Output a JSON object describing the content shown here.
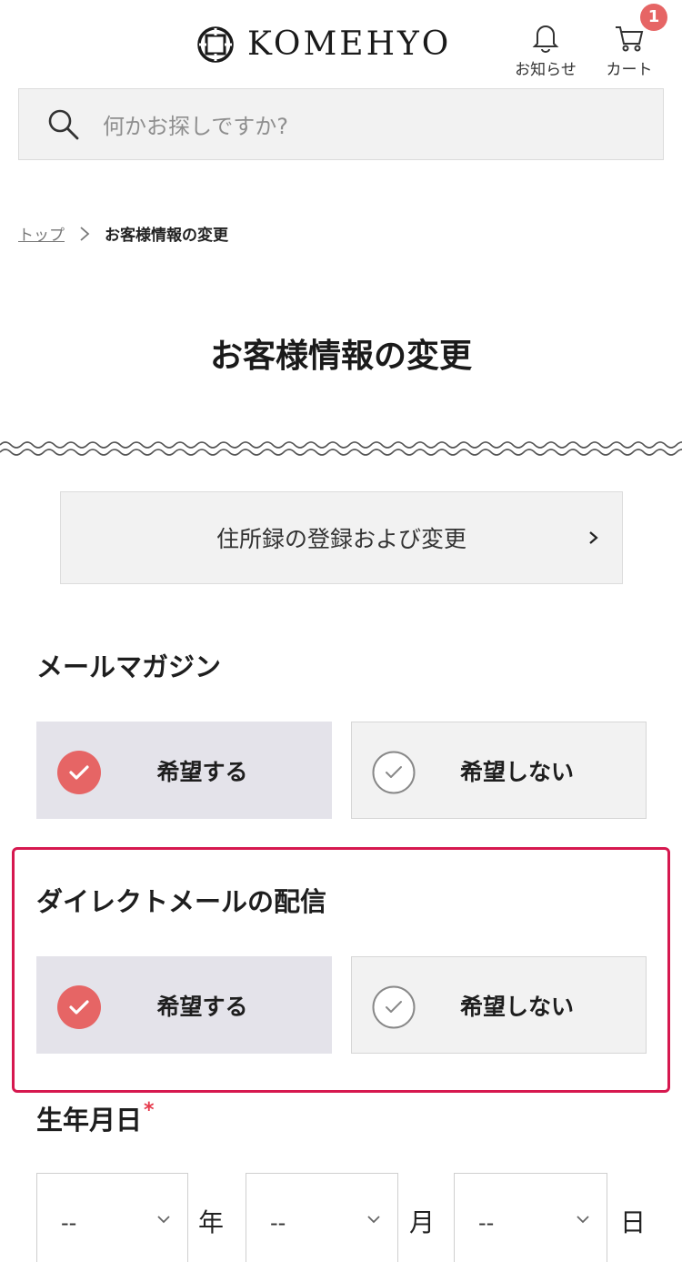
{
  "header": {
    "logo_text": "KOMEHYO",
    "notifications_label": "お知らせ",
    "cart_label": "カート",
    "cart_count": "1",
    "badge_color": "#e66565"
  },
  "search": {
    "placeholder": "何かお探しですか?"
  },
  "breadcrumb": {
    "home": "トップ",
    "current": "お客様情報の変更"
  },
  "page_title": "お客様情報の変更",
  "address_book": {
    "label": "住所録の登録および変更"
  },
  "mail_magazine": {
    "title": "メールマガジン",
    "options": [
      {
        "label": "希望する",
        "selected": true
      },
      {
        "label": "希望しない",
        "selected": false
      }
    ]
  },
  "direct_mail": {
    "title": "ダイレクトメールの配信",
    "options": [
      {
        "label": "希望する",
        "selected": true
      },
      {
        "label": "希望しない",
        "selected": false
      }
    ],
    "highlight_color": "#d6184f"
  },
  "birthday": {
    "title": "生年月日",
    "required_mark": "*",
    "year_value": "--",
    "year_unit": "年",
    "month_value": "--",
    "month_unit": "月",
    "day_value": "--",
    "day_unit": "日"
  },
  "colors": {
    "checked": "#e66565",
    "selected_bg": "#e4e3ea",
    "option_bg": "#f2f2f2"
  }
}
